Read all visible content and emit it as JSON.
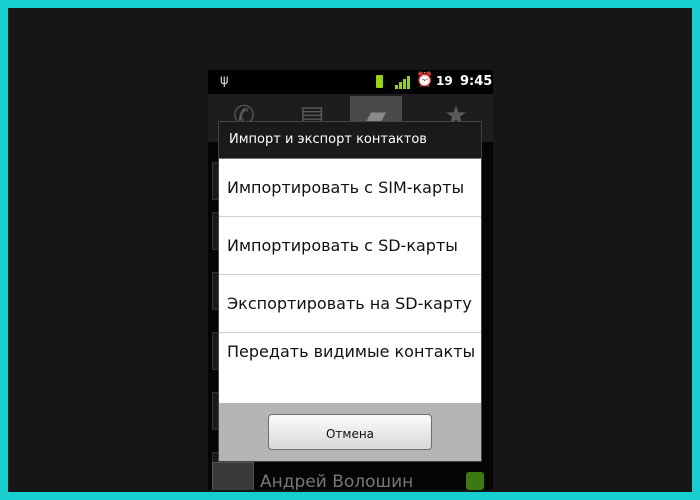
{
  "status_bar": {
    "usb_icon": "usb-icon",
    "battery_icon": "battery-icon",
    "signal_icon": "signal-icon",
    "alarm_icon": "alarm-icon",
    "notification_count": "19",
    "time": "9:45"
  },
  "tabs": [
    {
      "icon": "phone-icon"
    },
    {
      "icon": "call-log-icon"
    },
    {
      "icon": "contacts-folder-icon",
      "active": true
    },
    {
      "icon": "favorites-star-icon"
    }
  ],
  "dialog": {
    "title": "Импорт и экспорт контактов",
    "options": [
      {
        "label": "Импортировать с SIM-карты"
      },
      {
        "label": "Импортировать с SD-карты"
      },
      {
        "label": "Экспортировать на SD-карту"
      },
      {
        "label": "Передать видимые контакты"
      }
    ],
    "cancel_label": "Отмена"
  },
  "background_contact": {
    "name": "Андрей Волошин"
  },
  "colors": {
    "frame": "#17cfcf",
    "accent_green": "#9ad20b"
  }
}
